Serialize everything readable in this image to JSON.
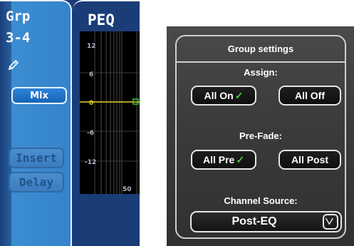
{
  "channel": {
    "type": "Grp",
    "number": "3-4",
    "edit_icon": "pencil-icon"
  },
  "strip": {
    "mix_label": "Mix",
    "insert_label": "Insert",
    "delay_label": "Delay"
  },
  "peq": {
    "title": "PEQ",
    "db_labels": [
      "12",
      "6",
      "0",
      "-6",
      "-12"
    ],
    "freq_label": "50"
  },
  "group_settings": {
    "title": "Group settings",
    "assign_label": "Assign:",
    "all_on_label": "All On",
    "all_off_label": "All Off",
    "prefade_label": "Pre-Fade:",
    "all_pre_label": "All Pre",
    "all_post_label": "All Post",
    "source_label": "Channel Source:",
    "source_value": "Post-EQ",
    "check_icon": "checkmark-icon",
    "dropdown_icon": "chevron-down-icon"
  },
  "colors": {
    "strip_blue": "#3b8ad0",
    "panel_navy": "#193c78",
    "eq_line": "#e4d12e",
    "eq_node": "#3ed13a",
    "check_green": "#3ed13a",
    "dialog_bg": "#3c3c3c"
  }
}
